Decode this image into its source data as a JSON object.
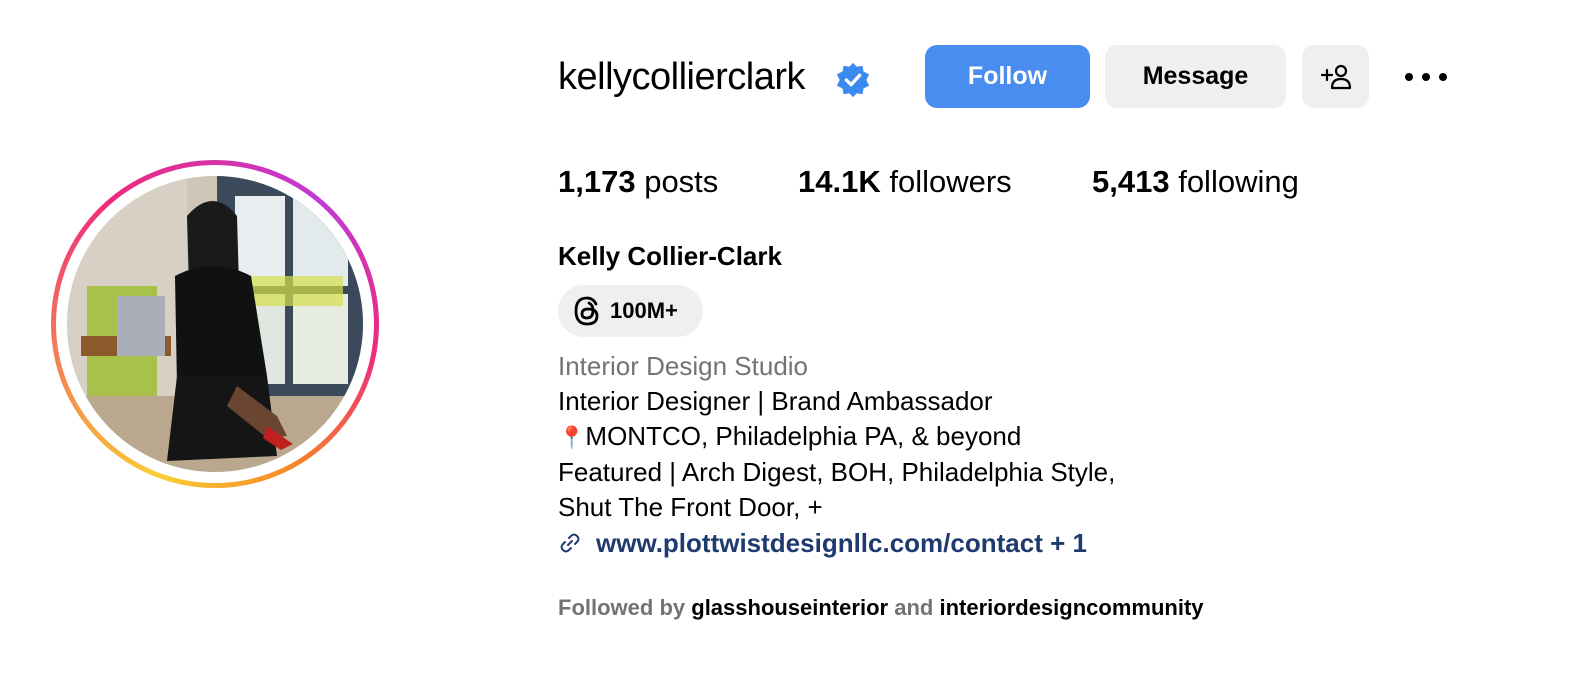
{
  "profile": {
    "username": "kellycollierclark",
    "full_name": "Kelly Collier-Clark",
    "verified_icon": "verified-badge-icon",
    "accent_color": "#4a8df0"
  },
  "actions": {
    "follow_label": "Follow",
    "message_label": "Message",
    "add_user_icon": "add-person-icon",
    "more_icon": "more-options-icon"
  },
  "stats": {
    "posts_count": "1,173",
    "posts_label": "posts",
    "followers_count": "14.1K",
    "followers_label": "followers",
    "following_count": "5,413",
    "following_label": "following"
  },
  "threads_badge": {
    "icon": "threads-icon",
    "label": "100M+"
  },
  "bio": {
    "category": "Interior Design Studio",
    "line1": "Interior Designer | Brand Ambassador",
    "pin_icon": "📍",
    "line2": "MONTCO, Philadelphia PA, & beyond",
    "line3": "Featured | Arch Digest, BOH, Philadelphia Style,",
    "line4": "Shut The Front Door, +",
    "link_icon": "link-icon",
    "link": "www.plottwistdesignllc.com/contact + 1"
  },
  "followed_by": {
    "prefix": "Followed by",
    "account1": "glasshouseinterior",
    "conjunction": "and",
    "account2": "interiordesigncommunity"
  }
}
